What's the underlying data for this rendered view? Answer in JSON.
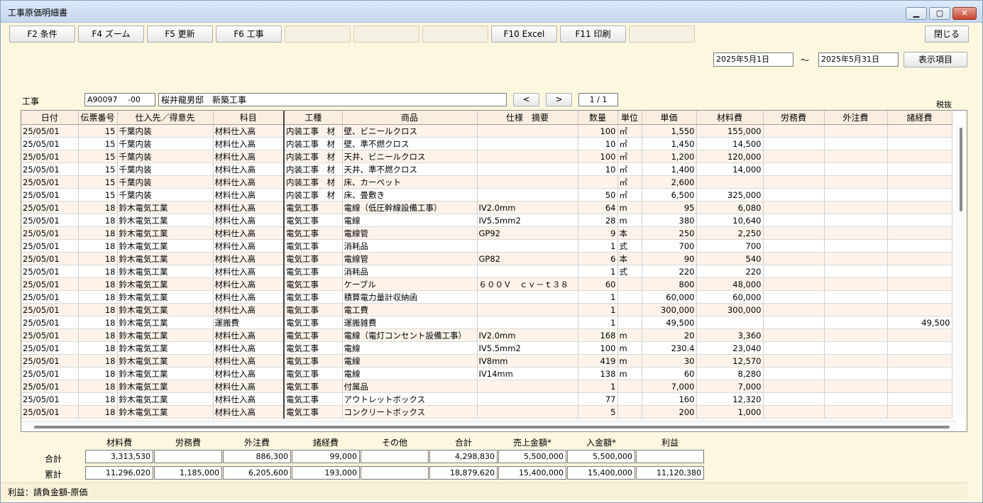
{
  "window": {
    "title": "工事原価明細書"
  },
  "toolbar": {
    "f2": "F2 条件",
    "f4": "F4 ズーム",
    "f5": "F5 更新",
    "f6": "F6 工事",
    "f10": "F10 Excel",
    "f11": "F11 印刷",
    "close": "閉じる"
  },
  "period": {
    "from": "2025年5月1日",
    "sep": "～",
    "to": "2025年5月31日",
    "display_items": "表示項目"
  },
  "project": {
    "label": "工事",
    "code": "A90097　 -00",
    "name": "桜井龍男邸　新築工事",
    "prev": "<",
    "next": ">",
    "page": "1 / 1",
    "tax_note": "税抜"
  },
  "grid": {
    "headers": [
      "日付",
      "伝票番号",
      "仕入先／得意先",
      "科目",
      "工種",
      "商品",
      "仕様　摘要",
      "数量",
      "単位",
      "単価",
      "材料費",
      "労務費",
      "外注費",
      "諸経費"
    ],
    "rows": [
      [
        "25/05/01",
        "15",
        "千葉内装",
        "材料仕入高",
        "内装工事　材",
        "壁、ビニールクロス",
        "",
        "100",
        "㎡",
        "1,550",
        "155,000",
        "",
        "",
        ""
      ],
      [
        "25/05/01",
        "15",
        "千葉内装",
        "材料仕入高",
        "内装工事　材",
        "壁、準不燃クロス",
        "",
        "10",
        "㎡",
        "1,450",
        "14,500",
        "",
        "",
        ""
      ],
      [
        "25/05/01",
        "15",
        "千葉内装",
        "材料仕入高",
        "内装工事　材",
        "天井、ビニールクロス",
        "",
        "100",
        "㎡",
        "1,200",
        "120,000",
        "",
        "",
        ""
      ],
      [
        "25/05/01",
        "15",
        "千葉内装",
        "材料仕入高",
        "内装工事　材",
        "天井、準不燃クロス",
        "",
        "10",
        "㎡",
        "1,400",
        "14,000",
        "",
        "",
        ""
      ],
      [
        "25/05/01",
        "15",
        "千葉内装",
        "材料仕入高",
        "内装工事　材",
        "床、カーペット",
        "",
        "",
        "㎡",
        "2,600",
        "",
        "",
        "",
        ""
      ],
      [
        "25/05/01",
        "15",
        "千葉内装",
        "材料仕入高",
        "内装工事　材",
        "床、畳敷き",
        "",
        "50",
        "㎡",
        "6,500",
        "325,000",
        "",
        "",
        ""
      ],
      [
        "25/05/01",
        "18",
        "鈴木電気工業",
        "材料仕入高",
        "電気工事",
        "電線（低圧幹線設備工事）",
        "IV2.0mm",
        "64",
        "m",
        "95",
        "6,080",
        "",
        "",
        ""
      ],
      [
        "25/05/01",
        "18",
        "鈴木電気工業",
        "材料仕入高",
        "電気工事",
        "電線",
        "IV5.5mm2",
        "28",
        "m",
        "380",
        "10,640",
        "",
        "",
        ""
      ],
      [
        "25/05/01",
        "18",
        "鈴木電気工業",
        "材料仕入高",
        "電気工事",
        "電線管",
        "GP92",
        "9",
        "本",
        "250",
        "2,250",
        "",
        "",
        ""
      ],
      [
        "25/05/01",
        "18",
        "鈴木電気工業",
        "材料仕入高",
        "電気工事",
        "消耗品",
        "",
        "1",
        "式",
        "700",
        "700",
        "",
        "",
        ""
      ],
      [
        "25/05/01",
        "18",
        "鈴木電気工業",
        "材料仕入高",
        "電気工事",
        "電線管",
        "GP82",
        "6",
        "本",
        "90",
        "540",
        "",
        "",
        ""
      ],
      [
        "25/05/01",
        "18",
        "鈴木電気工業",
        "材料仕入高",
        "電気工事",
        "消耗品",
        "",
        "1",
        "式",
        "220",
        "220",
        "",
        "",
        ""
      ],
      [
        "25/05/01",
        "18",
        "鈴木電気工業",
        "材料仕入高",
        "電気工事",
        "ケーブル",
        "６００Ｖ　ｃｖ－ｔ３８",
        "60",
        "",
        "800",
        "48,000",
        "",
        "",
        ""
      ],
      [
        "25/05/01",
        "18",
        "鈴木電気工業",
        "材料仕入高",
        "電気工事",
        "積算電力量計収納函",
        "",
        "1",
        "",
        "60,000",
        "60,000",
        "",
        "",
        ""
      ],
      [
        "25/05/01",
        "18",
        "鈴木電気工業",
        "材料仕入高",
        "電気工事",
        "電工費",
        "",
        "1",
        "",
        "300,000",
        "300,000",
        "",
        "",
        ""
      ],
      [
        "25/05/01",
        "18",
        "鈴木電気工業",
        "運搬費",
        "電気工事",
        "運搬雑費",
        "",
        "1",
        "",
        "49,500",
        "",
        "",
        "",
        "49,500"
      ],
      [
        "25/05/01",
        "18",
        "鈴木電気工業",
        "材料仕入高",
        "電気工事",
        "電線（電灯コンセント設備工事）",
        "IV2.0mm",
        "168",
        "m",
        "20",
        "3,360",
        "",
        "",
        ""
      ],
      [
        "25/05/01",
        "18",
        "鈴木電気工業",
        "材料仕入高",
        "電気工事",
        "電線",
        "IV5.5mm2",
        "100",
        "m",
        "230.4",
        "23,040",
        "",
        "",
        ""
      ],
      [
        "25/05/01",
        "18",
        "鈴木電気工業",
        "材料仕入高",
        "電気工事",
        "電線",
        "IV8mm",
        "419",
        "m",
        "30",
        "12,570",
        "",
        "",
        ""
      ],
      [
        "25/05/01",
        "18",
        "鈴木電気工業",
        "材料仕入高",
        "電気工事",
        "電線",
        "IV14mm",
        "138",
        "m",
        "60",
        "8,280",
        "",
        "",
        ""
      ],
      [
        "25/05/01",
        "18",
        "鈴木電気工業",
        "材料仕入高",
        "電気工事",
        "付属品",
        "",
        "1",
        "",
        "7,000",
        "7,000",
        "",
        "",
        ""
      ],
      [
        "25/05/01",
        "18",
        "鈴木電気工業",
        "材料仕入高",
        "電気工事",
        "アウトレットボックス",
        "",
        "77",
        "",
        "160",
        "12,320",
        "",
        "",
        ""
      ],
      [
        "25/05/01",
        "18",
        "鈴木電気工業",
        "材料仕入高",
        "電気工事",
        "コンクリートボックス",
        "",
        "5",
        "",
        "200",
        "1,000",
        "",
        "",
        ""
      ]
    ]
  },
  "summary": {
    "headers": [
      "材料費",
      "労務費",
      "外注費",
      "諸経費",
      "その他",
      "合計",
      "売上金額*",
      "入金額*",
      "利益"
    ],
    "total_label": "合計",
    "cumulative_label": "累計",
    "total": [
      "3,313,530",
      "",
      "886,300",
      "99,000",
      "",
      "4,298,830",
      "5,500,000",
      "5,500,000",
      ""
    ],
    "cumulative": [
      "11,296,020",
      "1,185,000",
      "6,205,600",
      "193,000",
      "",
      "18,879,620",
      "15,400,000",
      "15,400,000",
      "11,120,380"
    ]
  },
  "status": {
    "text": "利益：請負金額-原価"
  }
}
